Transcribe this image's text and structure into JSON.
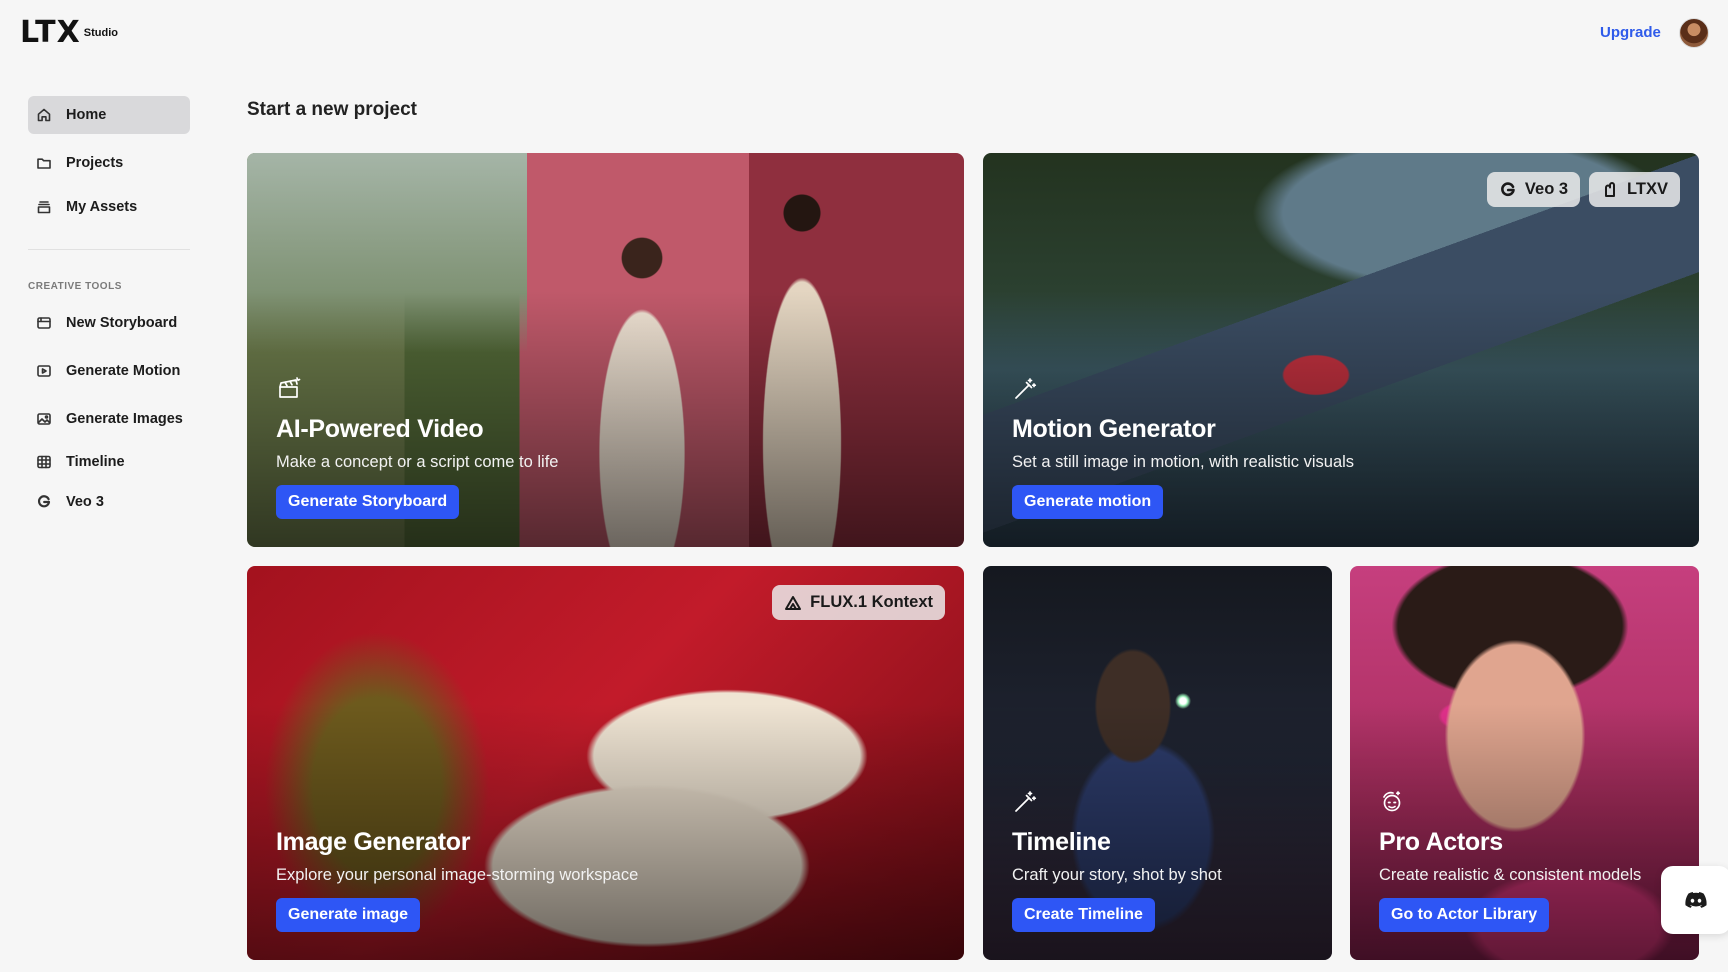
{
  "brand": {
    "logo": "LTX",
    "sub": "Studio"
  },
  "header": {
    "upgrade": "Upgrade"
  },
  "nav": {
    "items": [
      {
        "label": "Home",
        "icon": "home-icon"
      },
      {
        "label": "Projects",
        "icon": "folder-icon"
      },
      {
        "label": "My Assets",
        "icon": "assets-icon"
      }
    ],
    "section_label": "CREATIVE TOOLS",
    "tools": [
      {
        "label": "New Storyboard",
        "icon": "storyboard-icon"
      },
      {
        "label": "Generate Motion",
        "icon": "motion-icon"
      },
      {
        "label": "Generate Images",
        "icon": "images-icon"
      },
      {
        "label": "Timeline",
        "icon": "timeline-icon"
      },
      {
        "label": "Veo 3",
        "icon": "google-icon"
      }
    ]
  },
  "main": {
    "title": "Start a new project",
    "cards": [
      {
        "title": "AI-Powered Video",
        "subtitle": "Make a concept or a script come to life",
        "button": "Generate Storyboard",
        "icon": "clapper-icon"
      },
      {
        "title": "Motion Generator",
        "subtitle": "Set a still image in motion, with realistic visuals",
        "button": "Generate motion",
        "icon": "magic-wand-icon",
        "badges": [
          "Veo 3",
          "LTXV"
        ]
      },
      {
        "title": "Image Generator",
        "subtitle": "Explore your personal image-storming workspace",
        "button": "Generate image",
        "icon": "image-icon",
        "badges": [
          "FLUX.1 Kontext"
        ]
      },
      {
        "title": "Timeline",
        "subtitle": "Craft your story, shot by shot",
        "button": "Create Timeline",
        "icon": "magic-wand-icon"
      },
      {
        "title": "Pro Actors",
        "subtitle": "Create realistic & consistent models",
        "button": "Go to Actor Library",
        "icon": "actor-icon"
      }
    ]
  },
  "colors": {
    "accent": "#2e56f5",
    "link": "#2f5bea",
    "active_nav": "#d9d9db"
  }
}
